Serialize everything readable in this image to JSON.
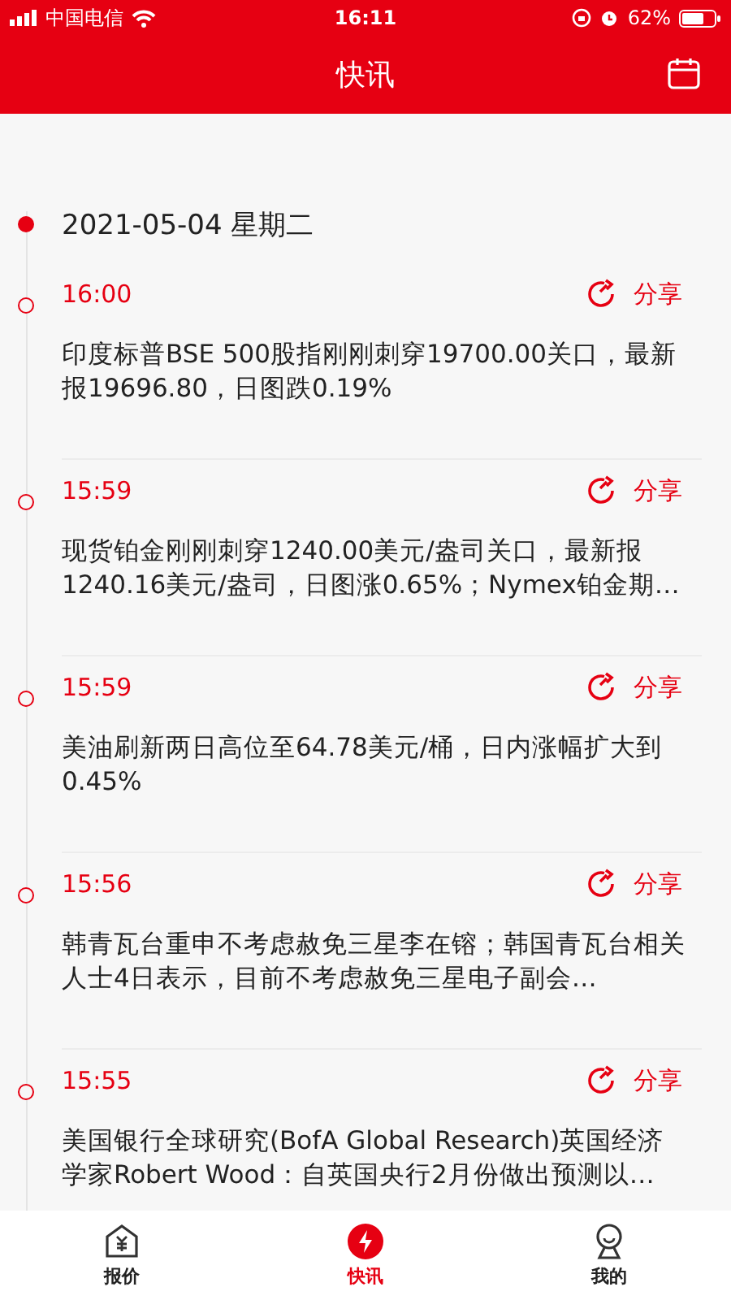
{
  "status_bar": {
    "carrier": "中国电信",
    "time": "16:11",
    "battery": "62%"
  },
  "header": {
    "title": "快讯"
  },
  "date": "2021-05-04 星期二",
  "news": [
    {
      "time": "16:00",
      "share": "分享",
      "text": "印度标普BSE 500股指刚刚刺穿19700.00关口，最新报19696.80，日图跌0.19%"
    },
    {
      "time": "15:59",
      "share": "分享",
      "text": "现货铂金刚刚刺穿1240.00美元/盎司关口，最新报1240.16美元/盎司，日图涨0.65%；Nymex铂金期…"
    },
    {
      "time": "15:59",
      "share": "分享",
      "text": "美油刷新两日高位至64.78美元/桶，日内涨幅扩大到0.45%"
    },
    {
      "time": "15:56",
      "share": "分享",
      "text": "韩青瓦台重申不考虑赦免三星李在镕；韩国青瓦台相关人士4日表示，目前不考虑赦免三星电子副会…"
    },
    {
      "time": "15:55",
      "share": "分享",
      "text": "美国银行全球研究(BofA Global Research)英国经济学家Robert Wood：自英国央行2月份做出预测以…"
    }
  ],
  "tabs": [
    {
      "kind": "quote",
      "label": "报价",
      "selected": false
    },
    {
      "kind": "flash",
      "label": "快讯",
      "selected": true
    },
    {
      "kind": "me",
      "label": "我的",
      "selected": false
    }
  ]
}
